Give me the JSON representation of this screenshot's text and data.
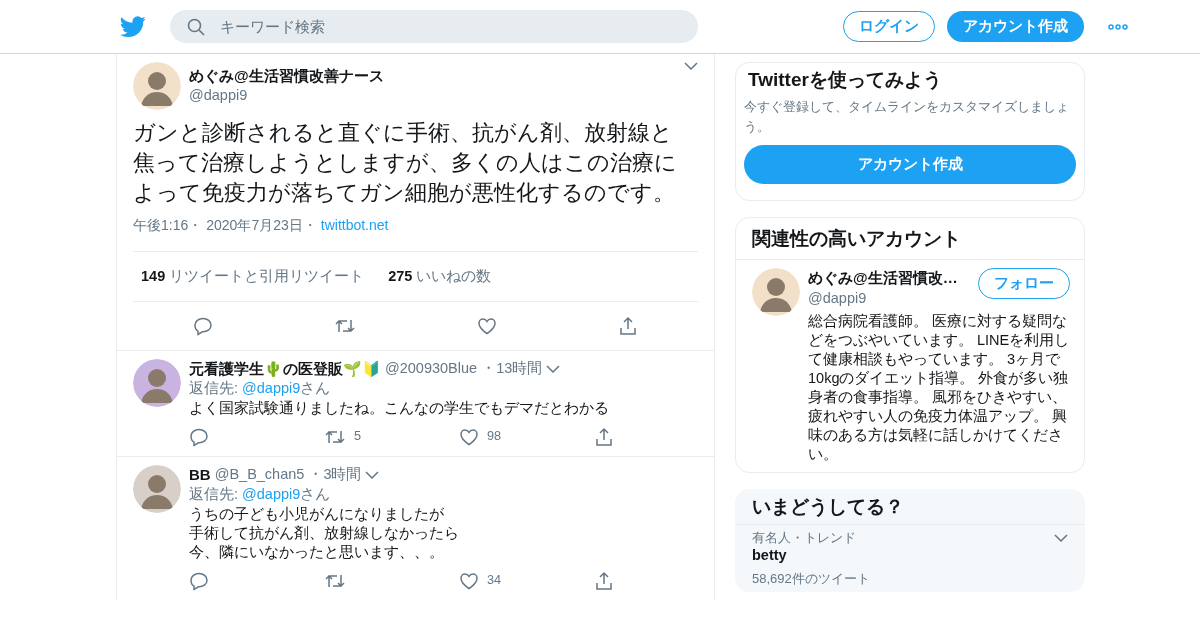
{
  "header": {
    "search": {
      "placeholder": "キーワード検索"
    },
    "login": "ログイン",
    "signup": "アカウント作成"
  },
  "tweet": {
    "name": "めぐみ@生活習慣改善ナース",
    "handle": "@dappi9",
    "text": [
      "ガンと診断されると直ぐに手術、抗がん剤、放射線と",
      "焦って治療しようとしますが、多くの人はこの治療に",
      "よって免疫力が落ちてガン細胞が悪性化するのです。"
    ],
    "time": "午後1:16・",
    "date": "2020年7月23日・",
    "source": "twittbot.net",
    "retweets": {
      "count": "149",
      "label": "リツイートと引用リツイート"
    },
    "likes": {
      "count": "275",
      "label": "いいねの数"
    }
  },
  "replies": [
    {
      "name": "元看護学生🌵の医登販🌱🔰",
      "handle": "@200930Blue",
      "time": "・13時間",
      "reply_prefix": "返信先:",
      "reply_to": "@dappi9",
      "reply_suffix": "さん",
      "text": [
        "よく国家試験通りましたね。こんなの学生でもデマだとわかる"
      ],
      "retweets": "5",
      "likes": "98"
    },
    {
      "name": "BB",
      "handle": "@B_B_chan5",
      "time": "・3時間",
      "reply_prefix": "返信先:",
      "reply_to": "@dappi9",
      "reply_suffix": "さん",
      "text": [
        "うちの子ども小児がんになりましたが",
        "手術して抗がん剤、放射線しなかったら",
        "今、隣にいなかったと思います、、。"
      ],
      "likes": "34"
    }
  ],
  "signup_card": {
    "title": "Twitterを使ってみよう",
    "text": "今すぐ登録して、タイムラインをカスタマイズしましょう。",
    "button": "アカウント作成"
  },
  "related": {
    "title": "関連性の高いアカウント",
    "accounts": [
      {
        "name": "めぐみ@生活習慣改…",
        "handle": "@dappi9",
        "button": "フォロー",
        "bio": "総合病院看護師。 医療に対する疑問などをつぶやいています。 LINEを利用して健康相談もやっています。 3ヶ月で10kgのダイエット指導。 外食が多い独身者の食事指導。 風邪をひきやすい、疲れやすい人の免疫力体温アップ。 興味のある方は気軽に話しかけてください。"
      }
    ]
  },
  "trends": {
    "title": "いまどうしてる？",
    "items": [
      {
        "context": "有名人・トレンド",
        "name": "betty",
        "count": "58,692件のツイート"
      }
    ]
  }
}
